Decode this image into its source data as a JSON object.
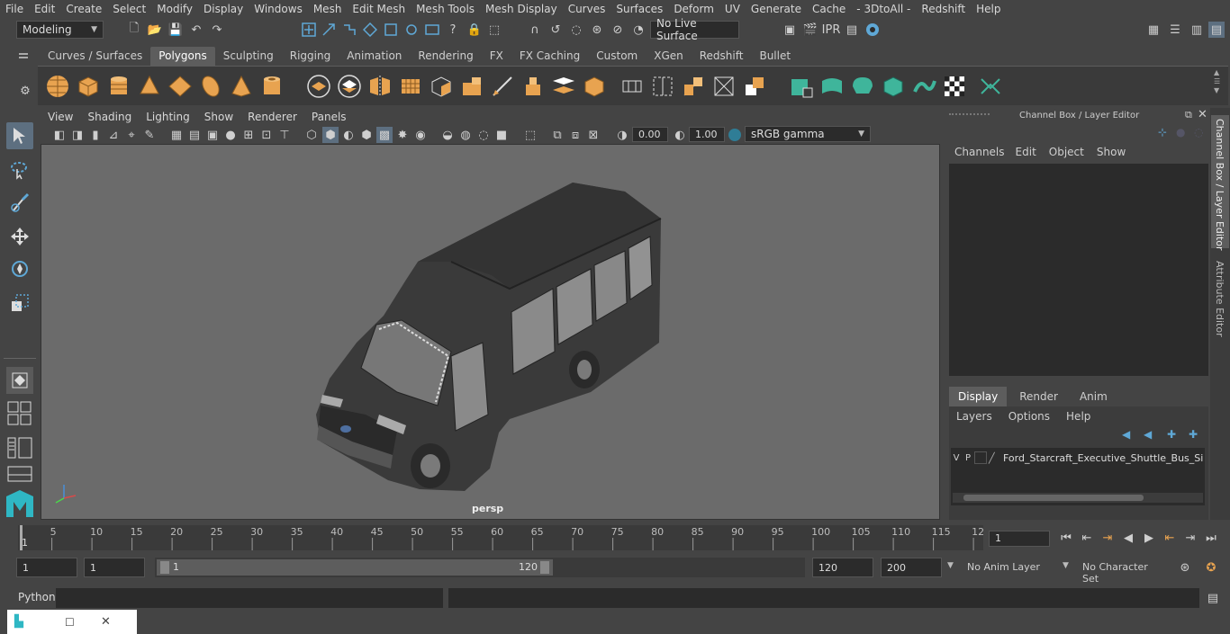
{
  "menubar": {
    "items": [
      "File",
      "Edit",
      "Create",
      "Select",
      "Modify",
      "Display",
      "Windows",
      "Mesh",
      "Edit Mesh",
      "Mesh Tools",
      "Mesh Display",
      "Curves",
      "Surfaces",
      "Deform",
      "UV",
      "Generate",
      "Cache",
      "- 3DtoAll -",
      "Redshift",
      "Help"
    ]
  },
  "statusline": {
    "mode": "Modeling",
    "live_surface": "No Live Surface"
  },
  "shelf": {
    "tabs": [
      "Curves / Surfaces",
      "Polygons",
      "Sculpting",
      "Rigging",
      "Animation",
      "Rendering",
      "FX",
      "FX Caching",
      "Custom",
      "XGen",
      "Redshift",
      "Bullet"
    ],
    "active_tab": "Polygons"
  },
  "viewport": {
    "menu": [
      "View",
      "Shading",
      "Lighting",
      "Show",
      "Renderer",
      "Panels"
    ],
    "exposure": "0.00",
    "gamma": "1.00",
    "color_space": "sRGB gamma",
    "camera_label": "persp"
  },
  "channel_box": {
    "title": "Channel Box / Layer Editor",
    "menu": [
      "Channels",
      "Edit",
      "Object",
      "Show"
    ],
    "layer_tabs": [
      "Display",
      "Render",
      "Anim"
    ],
    "active_layer_tab": "Display",
    "layer_menu": [
      "Layers",
      "Options",
      "Help"
    ],
    "layer": {
      "v": "V",
      "p": "P",
      "name": "Ford_Starcraft_Executive_Shuttle_Bus_Simpl"
    }
  },
  "side_tabs": [
    "Channel Box / Layer Editor",
    "Attribute Editor"
  ],
  "timeline": {
    "ticks": [
      "5",
      "10",
      "15",
      "20",
      "25",
      "30",
      "35",
      "40",
      "45",
      "50",
      "55",
      "60",
      "65",
      "70",
      "75",
      "80",
      "85",
      "90",
      "95",
      "100",
      "105",
      "110",
      "115",
      "12"
    ],
    "start_marker": "1",
    "current_frame": "1"
  },
  "range": {
    "start": "1",
    "start2": "1",
    "slider_start": "1",
    "slider_end": "120",
    "end": "120",
    "end2": "200",
    "anim_layer": "No Anim Layer",
    "char_set": "No Character Set"
  },
  "cmdline": {
    "label": "Python"
  },
  "colors": {
    "accent": "#5fa8d6",
    "shelf_green": "#3fb59b",
    "shelf_orange": "#e8a350"
  }
}
